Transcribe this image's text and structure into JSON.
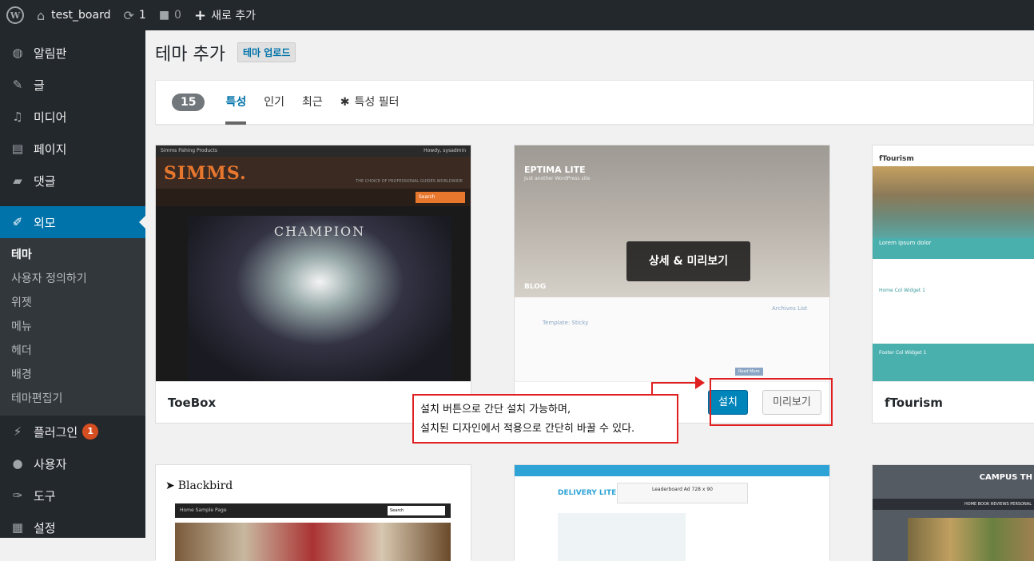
{
  "adminbar": {
    "site_name": "test_board",
    "updates_count": "1",
    "comments_count": "0",
    "new_label": "새로 추가"
  },
  "sidebar": {
    "items": [
      {
        "label": "알림판",
        "icon": "dashboard-icon"
      },
      {
        "label": "글",
        "icon": "pin-icon"
      },
      {
        "label": "미디어",
        "icon": "media-icon"
      },
      {
        "label": "페이지",
        "icon": "page-icon"
      },
      {
        "label": "댓글",
        "icon": "comment-icon"
      },
      {
        "label": "외모",
        "icon": "appearance-icon"
      },
      {
        "label": "플러그인",
        "icon": "plugin-icon",
        "badge": "1"
      },
      {
        "label": "사용자",
        "icon": "users-icon"
      },
      {
        "label": "도구",
        "icon": "tools-icon"
      },
      {
        "label": "설정",
        "icon": "settings-icon"
      }
    ],
    "submenu": [
      "테마",
      "사용자 정의하기",
      "위젯",
      "메뉴",
      "헤더",
      "배경",
      "테마편집기"
    ]
  },
  "page": {
    "title": "테마 추가",
    "upload_button": "테마 업로드"
  },
  "filter": {
    "count": "15",
    "tabs": [
      "특성",
      "인기",
      "최근"
    ],
    "feature_filter": "특성 필터"
  },
  "themes": [
    {
      "name": "ToeBox",
      "shot": {
        "brand": "SIMMS.",
        "tagline": "THE CHOICE OF PROFESSIONAL GUIDES WORLDWIDE",
        "banner": "CHAMPION",
        "search": "Search",
        "topbar": "Simms Fishing Products",
        "howdy": "Howdy, sysadmin"
      }
    },
    {
      "name": "",
      "overlay": "상세 & 미리보기",
      "install": "설치",
      "preview": "미리보기",
      "shot": {
        "brand": "EPTIMA LITE",
        "tagline": "Just another WordPress site",
        "blog": "BLOG",
        "post": "Template: Sticky",
        "archives": "Archives List",
        "read_more": "Read More"
      }
    },
    {
      "name": "fTourism",
      "shot": {
        "brand": "fTourism",
        "lorem": "Lorem ipsum dolor",
        "home_widget": "Home Col Widget 1",
        "footer_widget": "Footer Col Widget 1"
      }
    },
    {
      "name": "",
      "shot": {
        "brand": "Blackbird",
        "nav": "Home   Sample Page",
        "search": "Search"
      }
    },
    {
      "name": "",
      "shot": {
        "brand": "DELIVERY LITE",
        "ad": "Leaderboard Ad 728 x 90"
      }
    },
    {
      "name": "",
      "shot": {
        "brand": "CAMPUS TH",
        "nav": "HOME  BOOK REVIEWS  PERSONAL"
      }
    }
  ],
  "callout": {
    "line1": "설치 버튼으로 간단 설치 가능하며,",
    "line2": "설치된 디자인에서 적용으로 간단히 바꿀 수 있다."
  },
  "colors": {
    "accent": "#0073aa",
    "primary_button": "#0085ba",
    "annotation": "#e02020"
  }
}
